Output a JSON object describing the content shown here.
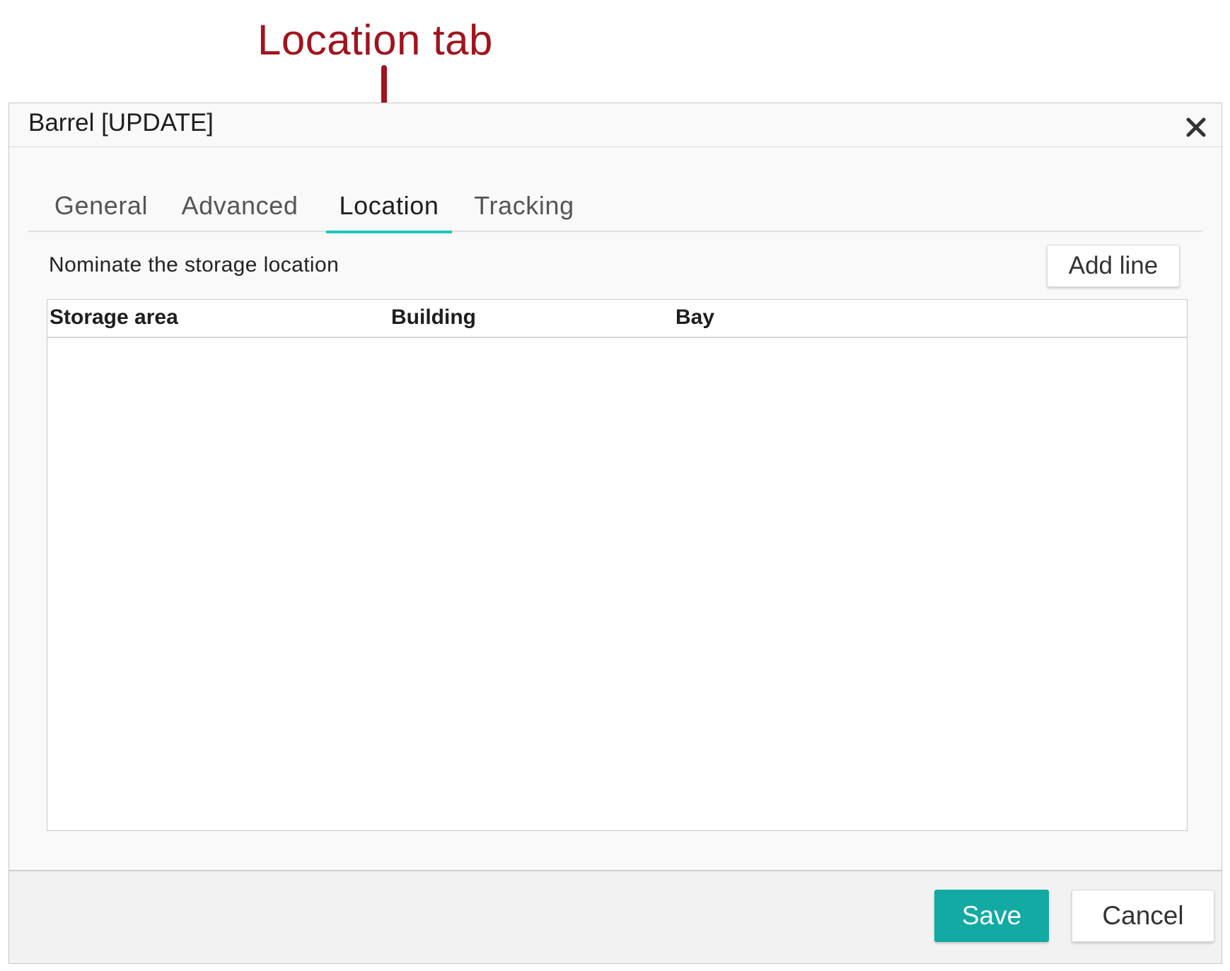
{
  "annotation": {
    "label": "Location tab"
  },
  "dialog": {
    "title": "Barrel [UPDATE]",
    "close_icon": "close-icon"
  },
  "tabs": [
    {
      "label": "General",
      "active": false
    },
    {
      "label": "Advanced",
      "active": false
    },
    {
      "label": "Location",
      "active": true
    },
    {
      "label": "Tracking",
      "active": false
    }
  ],
  "location": {
    "instruction": "Nominate the storage location",
    "add_line_label": "Add line",
    "columns": [
      "Storage area",
      "Building",
      "Bay"
    ],
    "rows": []
  },
  "footer": {
    "save_label": "Save",
    "cancel_label": "Cancel"
  },
  "colors": {
    "annotation": "#a0141e",
    "accent": "#1cc6c0",
    "save_button": "#12aaa3"
  }
}
